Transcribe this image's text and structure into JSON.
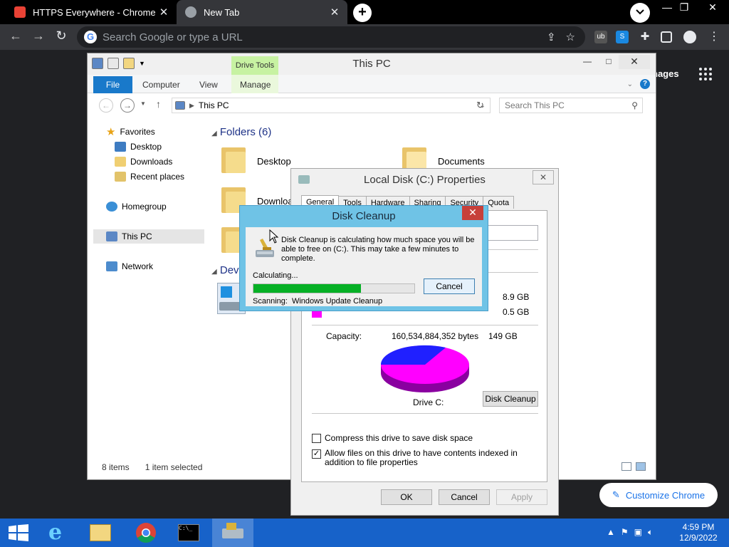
{
  "browser": {
    "tabs": [
      {
        "title": "HTTPS Everywhere - Chrome Web",
        "active": false
      },
      {
        "title": "New Tab",
        "active": true
      }
    ],
    "omnibox_placeholder": "Search Google or type a URL",
    "ntp": {
      "images_label": "nages",
      "customize_label": "Customize Chrome"
    }
  },
  "explorer": {
    "title": "This PC",
    "ribbon": {
      "file": "File",
      "tabs": [
        "Computer",
        "View",
        "Manage"
      ],
      "contextual": "Drive Tools"
    },
    "address": "This PC",
    "search_placeholder": "Search This PC",
    "nav": {
      "favorites": "Favorites",
      "desktop": "Desktop",
      "downloads": "Downloads",
      "recent": "Recent places",
      "homegroup": "Homegroup",
      "thispc": "This PC",
      "network": "Network"
    },
    "folders_header": "Folders (6)",
    "devices_header": "Dev",
    "folders": {
      "desktop": "Desktop",
      "documents": "Documents",
      "downloads": "Downloa"
    },
    "status": {
      "items": "8 items",
      "selected": "1 item selected"
    }
  },
  "properties": {
    "title": "Local Disk (C:) Properties",
    "tabs": [
      "General",
      "Tools",
      "Hardware",
      "Sharing",
      "Security",
      "Quota"
    ],
    "used_value": "8.9 GB",
    "free_value": "0.5 GB",
    "capacity_label": "Capacity:",
    "capacity_bytes": "160,534,884,352 bytes",
    "capacity_gb": "149 GB",
    "drive_label": "Drive C:",
    "disk_cleanup_button": "Disk Cleanup",
    "compress_label": "Compress this drive to save disk space",
    "index_label": "Allow files on this drive to have contents indexed in addition to file properties",
    "compress_checked": false,
    "index_checked": true,
    "ok": "OK",
    "cancel": "Cancel",
    "apply": "Apply",
    "colors": {
      "used": "#2020ff",
      "free": "#ff00ff"
    }
  },
  "cleanup": {
    "title": "Disk Cleanup",
    "message": "Disk Cleanup is calculating how much space you will be able to free on  (C:). This may take a few minutes to complete.",
    "calculating": "Calculating...",
    "progress": 0.67,
    "scanning_label": "Scanning:",
    "scanning_item": "Windows Update Cleanup",
    "cancel": "Cancel"
  },
  "taskbar": {
    "time": "4:59 PM",
    "date": "12/9/2022"
  }
}
